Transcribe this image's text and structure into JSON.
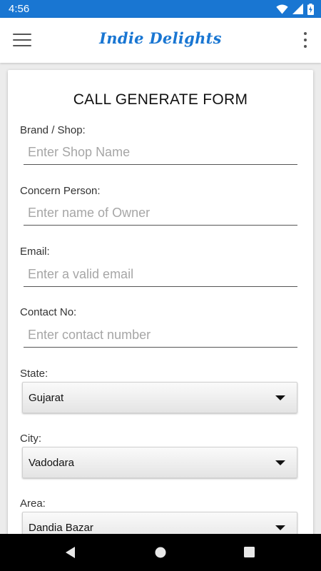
{
  "status_bar": {
    "time": "4:56"
  },
  "app_bar": {
    "title": "Indie Delights"
  },
  "form": {
    "title": "CALL GENERATE FORM",
    "fields": [
      {
        "label": "Brand / Shop:",
        "placeholder": "Enter Shop Name",
        "value": ""
      },
      {
        "label": "Concern Person:",
        "placeholder": "Enter name of Owner",
        "value": ""
      },
      {
        "label": "Email:",
        "placeholder": "Enter a valid email",
        "value": ""
      },
      {
        "label": "Contact No:",
        "placeholder": "Enter contact number",
        "value": ""
      }
    ],
    "dropdowns": [
      {
        "label": "State:",
        "value": "Gujarat"
      },
      {
        "label": "City:",
        "value": "Vadodara"
      },
      {
        "label": "Area:",
        "value": "Dandia Bazar"
      }
    ]
  },
  "colors": {
    "primary": "#1976d2",
    "status_bar": "#1976d2",
    "nav_bar": "#000000",
    "background": "#ececec",
    "card": "#ffffff"
  },
  "icons": {
    "status": [
      "wifi-icon",
      "signal-icon",
      "battery-charging-icon"
    ],
    "app_bar": [
      "hamburger-menu-icon",
      "overflow-menu-icon"
    ],
    "nav": [
      "back-icon",
      "home-icon",
      "recents-icon"
    ],
    "dropdown": "dropdown-caret-icon"
  }
}
